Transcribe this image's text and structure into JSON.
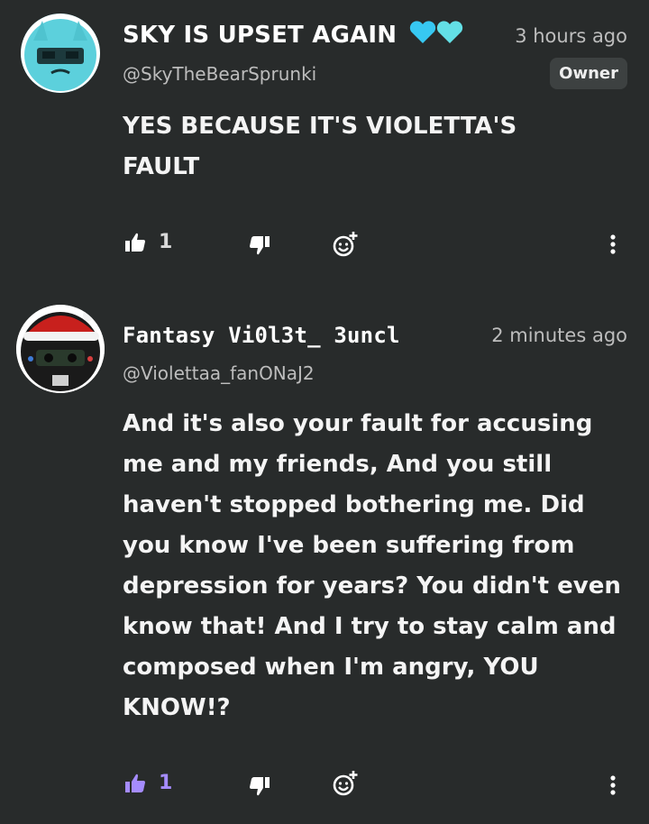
{
  "comments": [
    {
      "display_name": "SKY IS UPSET AGAIN",
      "name_hearts": "💙🩵",
      "time": "3 hours ago",
      "handle": "@SkyTheBearSprunki",
      "badge": "Owner",
      "text_lines": [
        "YES BECAUSE IT'S VIOLETTA'S",
        "FAULT"
      ],
      "like_count": "1",
      "liked": false,
      "like_color": "#ffffff"
    },
    {
      "display_name": "Fantasy Vi0l3t_ 3uncl",
      "time": "2 minutes ago",
      "handle": "@Violettaa_fanONaJ2",
      "text_lines": [
        "And it's also your fault for accusing",
        "me and my friends, And you still",
        "haven't stopped bothering me. Did",
        "you know I've been suffering from",
        "depression for years? You didn't even",
        "know that! And I try to stay calm and",
        "composed when I'm angry, YOU",
        "KNOW!?"
      ],
      "like_count": "1",
      "liked": true,
      "like_color": "#a58cff"
    }
  ],
  "icons": {
    "like": "thumbs-up-icon",
    "dislike": "thumbs-down-icon",
    "react": "add-emoji-icon",
    "more": "more-vertical-icon"
  }
}
